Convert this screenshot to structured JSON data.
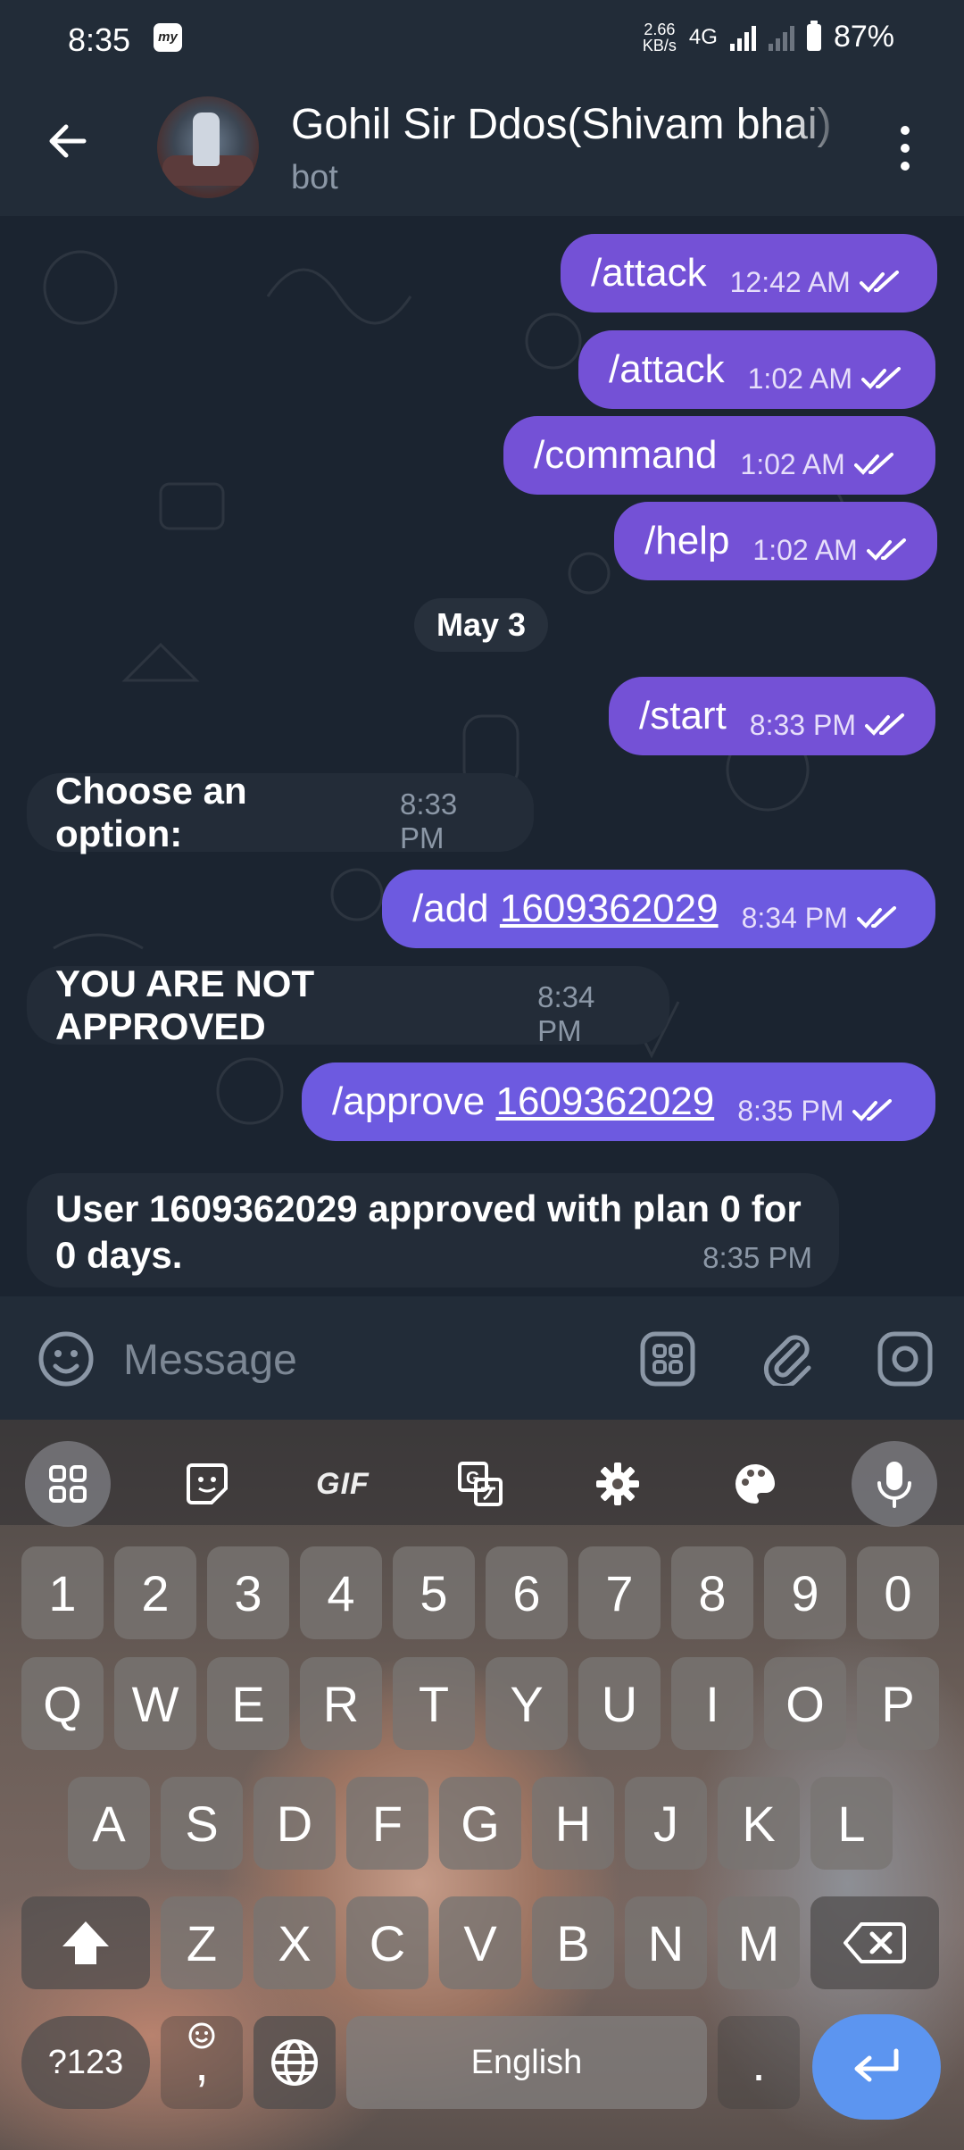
{
  "status_bar": {
    "time": "8:35",
    "app_badge": "my",
    "speed": "2.66",
    "speed_unit": "KB/s",
    "network": "4G",
    "battery": "87%"
  },
  "header": {
    "title": "Gohil Sir Ddos(Shivam bhai)",
    "subtitle": "bot"
  },
  "messages": {
    "m1": {
      "text": "/attack",
      "time": "12:42 AM"
    },
    "m2": {
      "text": "/attack",
      "time": "1:02 AM"
    },
    "m3": {
      "text": "/command",
      "time": "1:02 AM"
    },
    "m4": {
      "text": "/help",
      "time": "1:02 AM"
    },
    "date": "May 3",
    "m5": {
      "text": "/start",
      "time": "8:33 PM"
    },
    "m6": {
      "text": "Choose an option:",
      "time": "8:33 PM"
    },
    "m7": {
      "cmd": "/add ",
      "link": "1609362029",
      "time": "8:34 PM"
    },
    "m8": {
      "text": "YOU ARE NOT APPROVED",
      "time": "8:34 PM"
    },
    "m9": {
      "cmd": "/approve ",
      "link": "1609362029",
      "time": "8:35 PM"
    },
    "m10": {
      "line1": "User 1609362029 approved with plan 0 for",
      "line2": "0 days.",
      "time": "8:35 PM"
    }
  },
  "input": {
    "placeholder": "Message"
  },
  "keyboard": {
    "gif": "GIF",
    "numbers": [
      "1",
      "2",
      "3",
      "4",
      "5",
      "6",
      "7",
      "8",
      "9",
      "0"
    ],
    "row1": [
      "Q",
      "W",
      "E",
      "R",
      "T",
      "Y",
      "U",
      "I",
      "O",
      "P"
    ],
    "row2": [
      "A",
      "S",
      "D",
      "F",
      "G",
      "H",
      "J",
      "K",
      "L"
    ],
    "row3": [
      "Z",
      "X",
      "C",
      "V",
      "B",
      "N",
      "M"
    ],
    "sym": "?123",
    "comma": ",",
    "space": "English",
    "period": "."
  },
  "colors": {
    "outgoing": "#7451d6",
    "incoming": "#232c38",
    "background": "#1b2430",
    "enter": "#5c95f0"
  }
}
